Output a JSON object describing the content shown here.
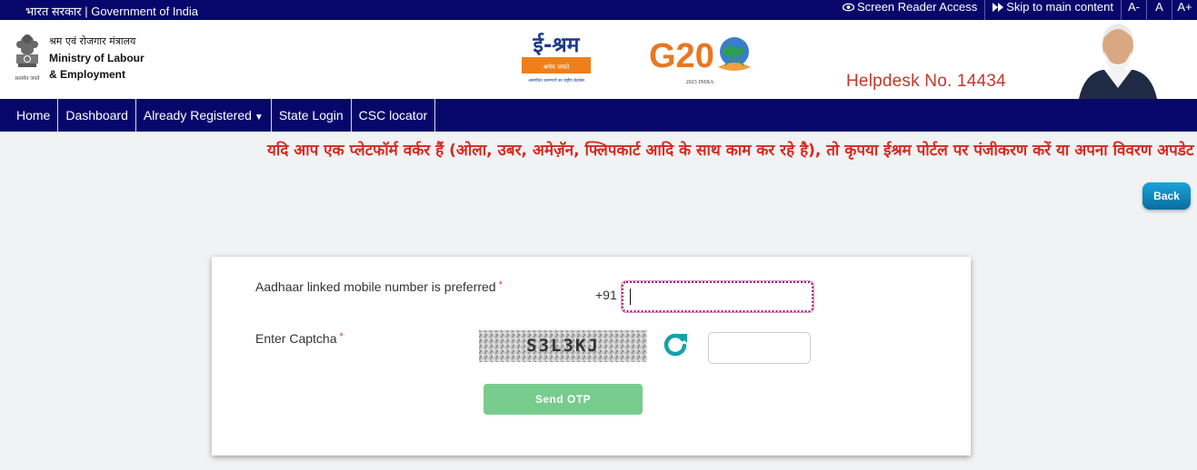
{
  "topbar": {
    "government": "भारत सरकार | Government of India",
    "screen_reader": "Screen Reader Access",
    "skip_content": "Skip to main content",
    "font_decrease": "A-",
    "font_normal": "A",
    "font_increase": "A+"
  },
  "header": {
    "ministry_hi": "श्रम एवं रोजगार मंत्रालय",
    "ministry_en_line1": "Ministry of Labour",
    "ministry_en_line2": "& Employment",
    "emblem_motto": "सत्यमेव जयते",
    "eshram_logo_text": "ई-श्रम",
    "eshram_tagline": "श्रमेव जयते",
    "eshram_subtitle": "असंगठित कामगारों का राष्ट्रीय डेटाबेस",
    "g20_text": "G20",
    "g20_subtitle": "2023 INDIA",
    "helpdesk": "Helpdesk No. 14434"
  },
  "nav": {
    "items": [
      {
        "label": "Home"
      },
      {
        "label": "Dashboard"
      },
      {
        "label": "Already Registered"
      },
      {
        "label": "State Login"
      },
      {
        "label": "CSC locator"
      }
    ]
  },
  "marquee": {
    "text": "यदि आप एक प्लेटफॉर्म वर्कर हैं (ओला, उबर, अमेज़ॅन, फ्लिपकार्ट आदि के साथ काम कर रहे है), तो कृपया ईश्रम पोर्टल पर पंजीकरण करें या अपना विवरण अपडेट करें"
  },
  "back_button": "Back",
  "form": {
    "mobile_label": "Aadhaar linked mobile number is preferred",
    "required_mark": "*",
    "country_code": "+91",
    "mobile_value": "",
    "captcha_label": "Enter Captcha",
    "captcha_code": "S3L3KJ",
    "captcha_value": "",
    "send_otp": "Send OTP"
  },
  "colors": {
    "navy": "#07076b",
    "helpdesk_red": "#c7362b",
    "marquee_red": "#d52a1e",
    "otp_green": "#77cc8d",
    "refresh_teal": "#16a2a8"
  }
}
